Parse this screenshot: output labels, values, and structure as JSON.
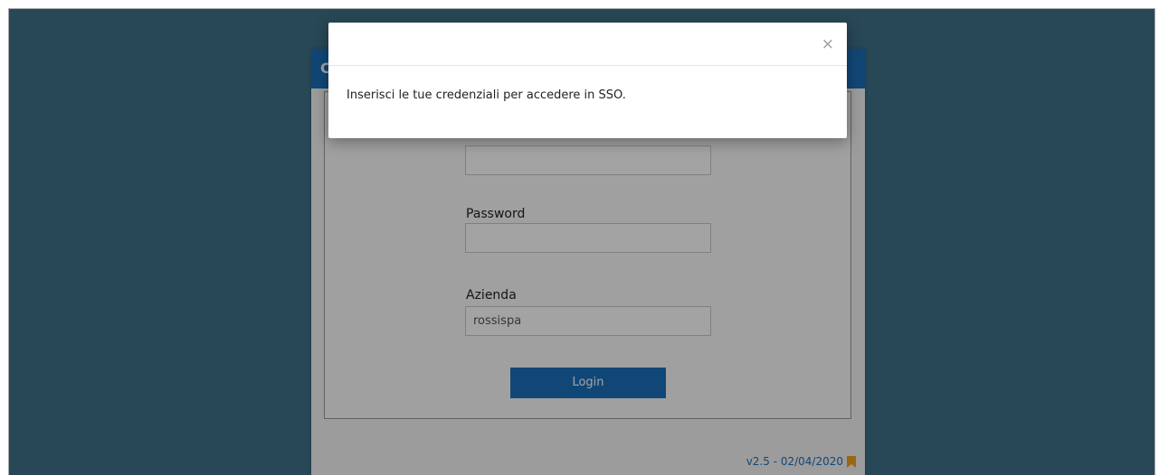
{
  "login": {
    "header_text": "C",
    "password_label": "Password",
    "azienda_label": "Azienda",
    "azienda_value": "rossispa",
    "login_button": "Login",
    "version": "v2.5 - 02/04/2020"
  },
  "modal": {
    "message": "Inserisci le tue credenziali per accedere in SSO.",
    "close_symbol": "×"
  },
  "icons": {
    "bookmark": "bookmark-icon",
    "close": "close-icon"
  },
  "colors": {
    "background": "#3f7189",
    "accent": "#1b6fba",
    "bookmark": "#f0a21b"
  }
}
